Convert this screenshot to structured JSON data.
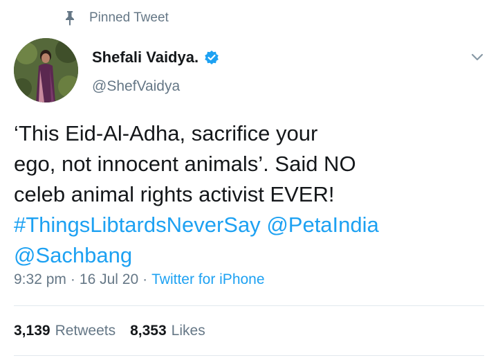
{
  "pinned": {
    "icon": "pin-icon",
    "label": "Pinned Tweet"
  },
  "user": {
    "name": "Shefali Vaidya.",
    "handle": "@ShefVaidya",
    "verified_icon": "verified-badge-icon",
    "avatar_icon": "profile-photo"
  },
  "menu": {
    "icon": "chevron-down-icon"
  },
  "tweet": {
    "text_line1": "‘This Eid-Al-Adha, sacrifice your",
    "text_line2": "ego, not innocent animals’. Said NO",
    "text_line3": "celeb animal rights activist EVER!",
    "hashtag": "#ThingsLibtardsNeverSay",
    "mention1": "@PetaIndia",
    "mention2": "@Sachbang"
  },
  "meta": {
    "time": "9:32 pm",
    "separator": "·",
    "date": "16 Jul 20",
    "source": "Twitter for iPhone"
  },
  "stats": {
    "retweets_count": "3,139",
    "retweets_label": "Retweets",
    "likes_count": "8,353",
    "likes_label": "Likes"
  },
  "colors": {
    "link": "#1da1f2",
    "secondary_text": "#657786",
    "primary_text": "#14171a",
    "divider": "#e1e8ed"
  }
}
